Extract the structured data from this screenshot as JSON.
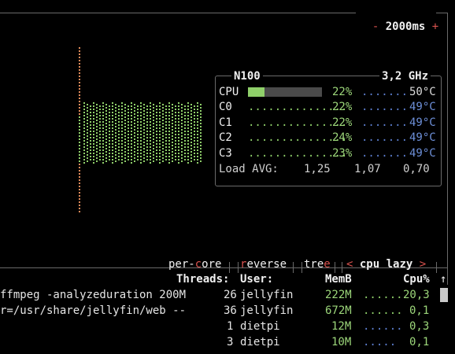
{
  "top_panel": {
    "minus": "-",
    "interval": "2000ms",
    "plus": "+"
  },
  "cpu": {
    "name": "N100",
    "freq": "3,2 GHz",
    "total": {
      "label": "CPU",
      "pct": "22%",
      "pct_value": 0.22,
      "temp": "50°C"
    },
    "cores": [
      {
        "label": "C0",
        "pct": "22%",
        "temp": "49°C"
      },
      {
        "label": "C1",
        "pct": "22%",
        "temp": "49°C"
      },
      {
        "label": "C2",
        "pct": "24%",
        "temp": "49°C"
      },
      {
        "label": "C3",
        "pct": "23%",
        "temp": "49°C"
      }
    ],
    "load_label": "Load AVG:",
    "load": [
      "1,25",
      "1,07",
      "0,70"
    ]
  },
  "proc_panel": {
    "tabs": {
      "per_core": {
        "prefix": "per-",
        "hot": "c",
        "suffix": "ore"
      },
      "reverse": {
        "hot": "r",
        "suffix": "everse"
      },
      "tree": {
        "prefix": "tre",
        "hot": "e"
      },
      "sort": {
        "left": "<",
        "label": "cpu lazy",
        "right": ">"
      }
    },
    "headers": {
      "threads": "Threads:",
      "user": "User:",
      "mem": "MemB",
      "cpu": "Cpu%",
      "arrow": "↑"
    },
    "rows": [
      {
        "cmd": "ffmpeg -analyzeduration 200M",
        "threads": "26",
        "user": "jellyfin",
        "mem": "222M",
        "cpu": "20,3"
      },
      {
        "cmd": "r=/usr/share/jellyfin/web --",
        "threads": "36",
        "user": "jellyfin",
        "mem": "672M",
        "cpu": "0,1"
      },
      {
        "cmd": "",
        "threads": "1",
        "user": "dietpi",
        "mem": "12M",
        "cpu": "0,3"
      },
      {
        "cmd": "",
        "threads": "3",
        "user": "dietpi",
        "mem": "10M",
        "cpu": "0,1"
      }
    ]
  },
  "colors": {
    "border": "#6a6a6a",
    "accent_red": "#d9534f",
    "graph_green": "#8fcf6a",
    "graph_orange": "#e08a5a",
    "temp_blue": "#6d8fd8"
  }
}
